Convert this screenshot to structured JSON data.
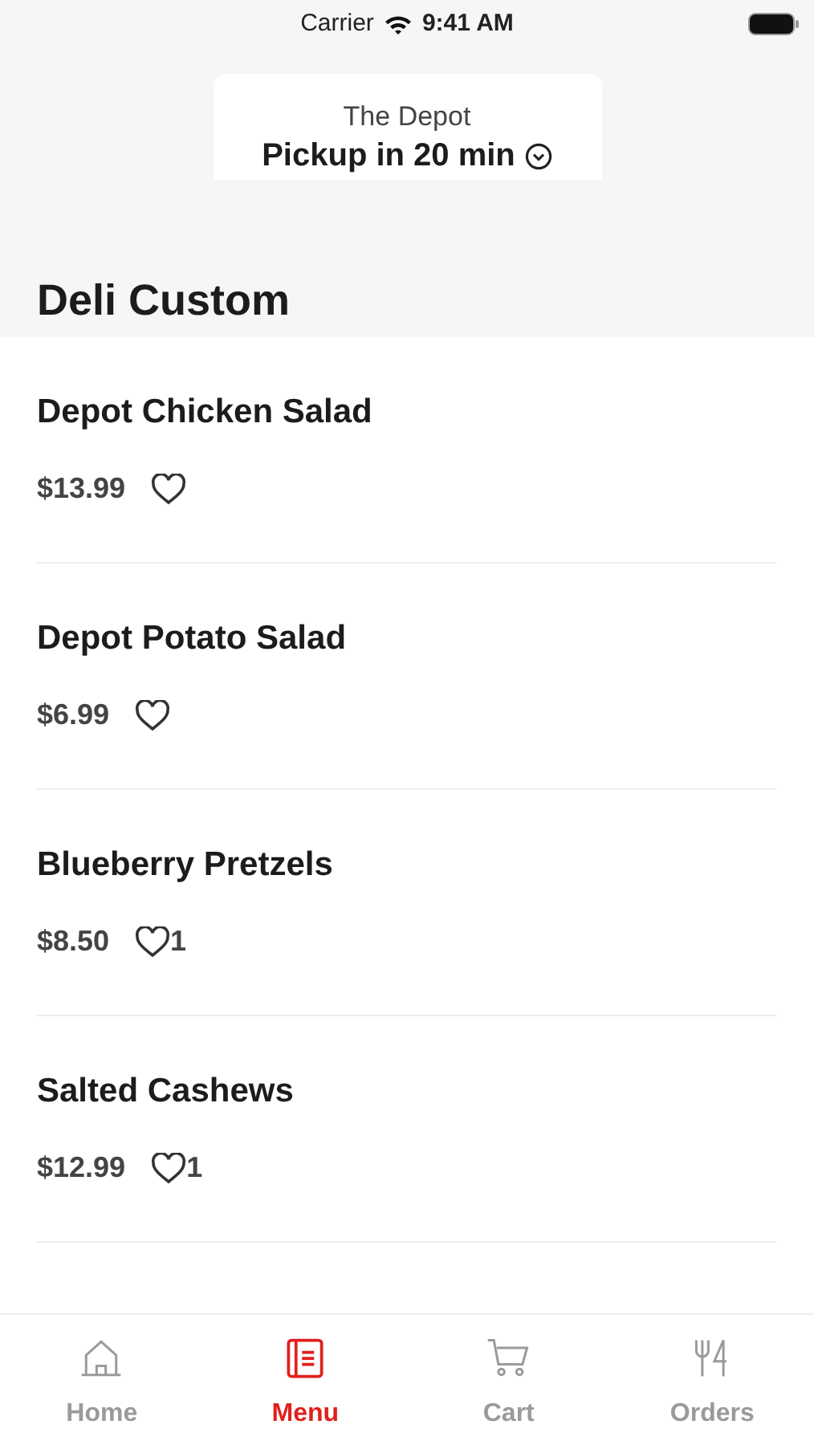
{
  "status_bar": {
    "carrier": "Carrier",
    "time": "9:41 AM"
  },
  "store_card": {
    "store": "The Depot",
    "pickup": "Pickup in 20 min"
  },
  "section_title": "Deli Custom",
  "items": [
    {
      "name": "Depot Chicken Salad",
      "price": "$13.99"
    },
    {
      "name": "Depot Potato Salad",
      "price": "$6.99"
    },
    {
      "name": "Blueberry Pretzels",
      "price": "$8.50",
      "likes": "1"
    },
    {
      "name": "Salted Cashews",
      "price": "$12.99",
      "likes": "1"
    }
  ],
  "tabs": [
    {
      "label": "Home",
      "selected": false
    },
    {
      "label": "Menu",
      "selected": true
    },
    {
      "label": "Cart",
      "selected": false
    },
    {
      "label": "Orders",
      "selected": false
    }
  ]
}
